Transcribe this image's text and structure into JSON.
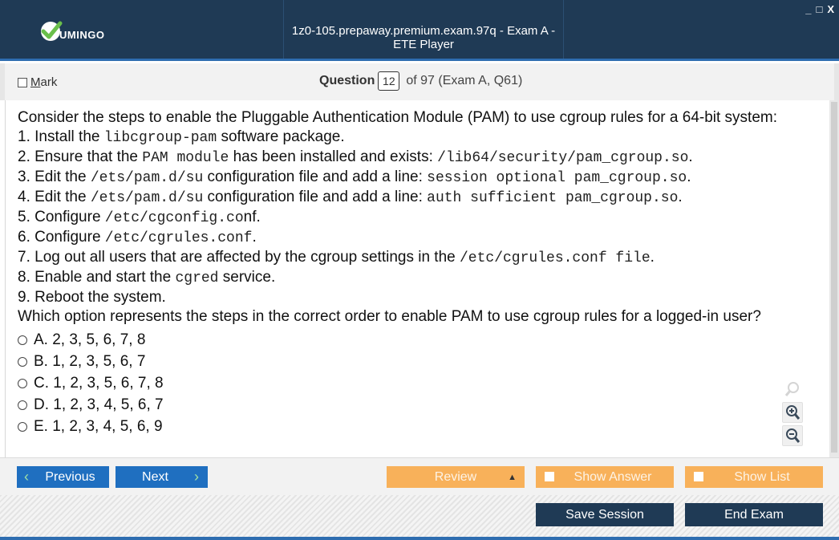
{
  "window": {
    "logo_text": "UMINGO",
    "title": "1z0-105.prepaway.premium.exam.97q - Exam A - ETE Player",
    "controls": [
      "_",
      "□",
      "X"
    ]
  },
  "question_header": {
    "mark_label_prefix": "M",
    "mark_label_rest": "ark",
    "question_label": "Question",
    "question_number": "12",
    "question_of": "of 97 (Exam A, Q61)"
  },
  "question": {
    "intro": "Consider the steps to enable the Pluggable Authentication Module (PAM) to use cgroup rules for a 64-bit system:",
    "steps": [
      {
        "pre": "1. Install the ",
        "code": "libcgroup-pam",
        "post": " software package."
      },
      {
        "pre": "2. Ensure that the ",
        "code": "PAM module",
        "post": " has been installed and exists: ",
        "code2": "/lib64/security/pam_cgroup.so",
        "post2": "."
      },
      {
        "pre": "3. Edit the ",
        "code": "/ets/pam.d/su",
        "post": " configuration file and add a line: ",
        "code2": "session optional pam_cgroup.so",
        "post2": "."
      },
      {
        "pre": "4. Edit the ",
        "code": "/ets/pam.d/su",
        "post": " configuration file and add a line: ",
        "code2": "auth sufficient pam_cgroup.so",
        "post2": "."
      },
      {
        "pre": "5. Configure ",
        "code": "/etc/cgconfig.co",
        "post": "nf."
      },
      {
        "pre": "6. Configure ",
        "code": "/etc/cgrules.conf",
        "post": "."
      },
      {
        "pre": "7. Log out all users that are affected by the cgroup settings in the ",
        "code": "/etc/cgrules.conf file",
        "post": "."
      },
      {
        "pre": "8. Enable and start the ",
        "code": "cgred",
        "post": " service."
      },
      {
        "pre": "9. Reboot the system.",
        "code": "",
        "post": ""
      }
    ],
    "prompt": "Which option represents the steps in the correct order to enable PAM to use cgroup rules for a logged-in user?",
    "options": [
      "A. 2, 3, 5, 6, 7, 8",
      "B. 1, 2, 3, 5, 6, 7",
      "C. 1, 2, 3, 5, 6, 7, 8",
      "D. 1, 2, 3, 4, 5, 6, 7",
      "E. 1, 2, 3, 4, 5, 6, 9"
    ]
  },
  "zoom_tools": [
    "magnifier-icon",
    "zoom-in-icon",
    "zoom-out-icon"
  ],
  "nav": {
    "previous_label": "Previous",
    "next_label": "Next",
    "review_label": "Review",
    "show_answer_label": "Show Answer",
    "show_list_label": "Show List"
  },
  "session": {
    "save_label": "Save Session",
    "end_label": "End Exam"
  },
  "colors": {
    "titlebar": "#1f3a55",
    "accent_blue": "#1f6fc0",
    "accent_orange": "#f8b15a",
    "logo_green": "#6abf4b"
  }
}
